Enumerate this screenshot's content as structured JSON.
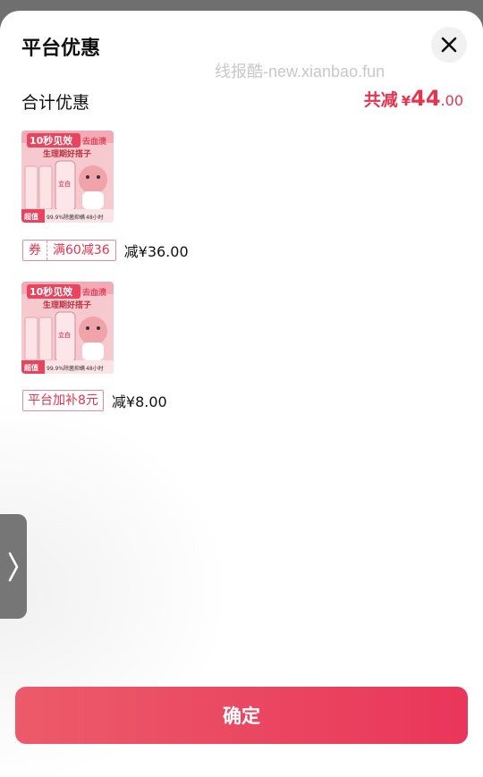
{
  "sheet": {
    "title": "平台优惠"
  },
  "watermark": "线报酷-new.xianbao.fun",
  "summary": {
    "label": "合计优惠",
    "total_label": "共减",
    "currency": "¥",
    "total_integer": "44",
    "total_decimal": ".00"
  },
  "products": [
    {
      "image_caption_top": "10秒见效",
      "image_caption_side": "去血渍",
      "image_caption_sub": "生理期好搭子",
      "image_badge": "超值",
      "image_bottom_text": "99.9%除菌抑螨",
      "image_bottom_hours": "48小时",
      "image_brand": "立白",
      "tag_kind": "券",
      "tag_rule": "满60减36",
      "reduce": "减¥36.00"
    },
    {
      "image_caption_top": "10秒见效",
      "image_caption_side": "去血渍",
      "image_caption_sub": "生理期好搭子",
      "image_badge": "超值",
      "image_bottom_text": "99.9%除菌抑螨",
      "image_bottom_hours": "48小时",
      "image_brand": "立白",
      "tag_single": "平台加补8元",
      "reduce": "减¥8.00"
    }
  ],
  "confirm_button": "确定",
  "colors": {
    "accent": "#e8334e",
    "button_start": "#ec5b6a",
    "button_end": "#e9365a"
  },
  "icons": {
    "close": "close-icon",
    "handle": "chevron-right-icon"
  }
}
